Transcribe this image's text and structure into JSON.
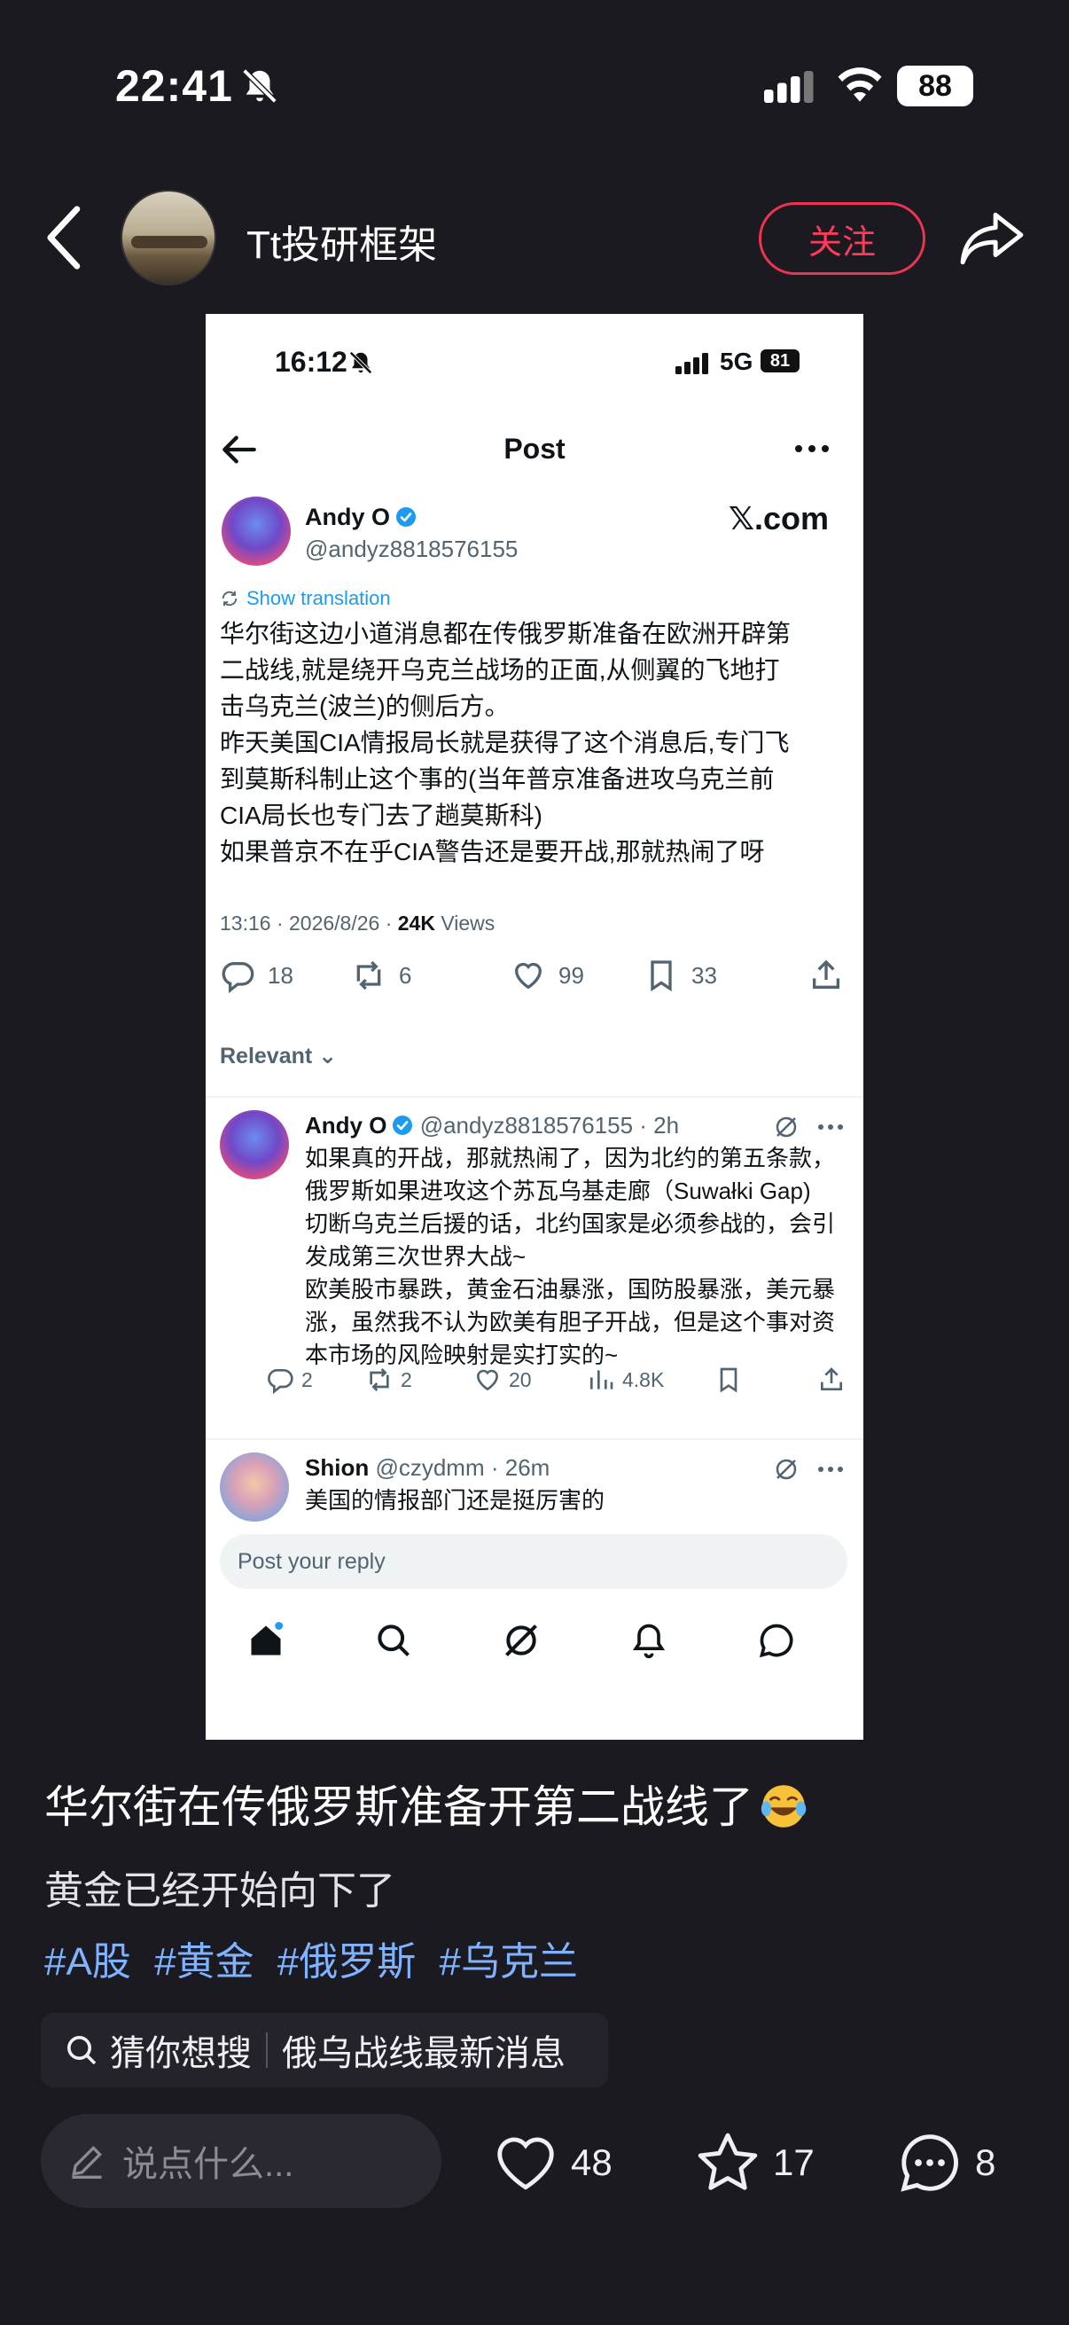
{
  "status_bar": {
    "time": "22:41",
    "battery": "88"
  },
  "header": {
    "author": "Tt投研框架",
    "follow_label": "关注"
  },
  "screenshot": {
    "status_time": "16:12",
    "network": "5G",
    "battery": "81",
    "page_title": "Post",
    "post": {
      "name": "Andy O",
      "handle": "@andyz8818576155",
      "site": "𝕏.com",
      "show_translation": "Show translation",
      "text_lines": [
        "华尔街这边小道消息都在传俄罗斯准备在欧洲开辟第",
        "二战线,就是绕开乌克兰战场的正面,从侧翼的飞地打",
        "击乌克兰(波兰)的侧后方。",
        "昨天美国CIA情报局长就是获得了这个消息后,专门飞",
        "到莫斯科制止这个事的(当年普京准备进攻乌克兰前",
        "CIA局长也专门去了趟莫斯科)",
        "如果普京不在乎CIA警告还是要开战,那就热闹了呀"
      ],
      "meta_time": "13:16 · 2026/8/26 · ",
      "views_count": "24K",
      "views_label": " Views",
      "replies": "18",
      "reposts": "6",
      "likes": "99",
      "bookmarks": "33"
    },
    "sort_label": "Relevant ⌄",
    "reply1": {
      "name": "Andy O",
      "handle_time": "@andyz8818576155 · 2h",
      "text_lines": [
        "如果真的开战，那就热闹了，因为北约的第五条款，",
        "俄罗斯如果进攻这个苏瓦乌基走廊（Suwałki Gap)",
        "切断乌克兰后援的话，北约国家是必须参战的，会引",
        "发成第三次世界大战~",
        "欧美股市暴跌，黄金石油暴涨，国防股暴涨，美元暴",
        "涨，虽然我不认为欧美有胆子开战，但是这个事对资",
        "本市场的风险映射是实打实的~"
      ],
      "replies": "2",
      "reposts": "2",
      "likes": "20",
      "views": "4.8K"
    },
    "reply2": {
      "name": "Shion",
      "handle_time": "@czydmm · 26m",
      "text": "美国的情报部门还是挺厉害的"
    },
    "reply_placeholder": "Post your reply"
  },
  "caption": {
    "title": "华尔街在传俄罗斯准备开第二战线了",
    "subtitle": "黄金已经开始向下了",
    "tags": [
      "#A股",
      "#黄金",
      "#俄罗斯",
      "#乌克兰"
    ],
    "search_label": "猜你想搜",
    "search_query": "俄乌战线最新消息"
  },
  "bottom_bar": {
    "comment_placeholder": "说点什么...",
    "likes": "48",
    "favorites": "17",
    "comments": "8"
  },
  "colors": {
    "follow": "#ef3452",
    "tag": "#7fb3ff",
    "link": "#1d9bf0"
  }
}
